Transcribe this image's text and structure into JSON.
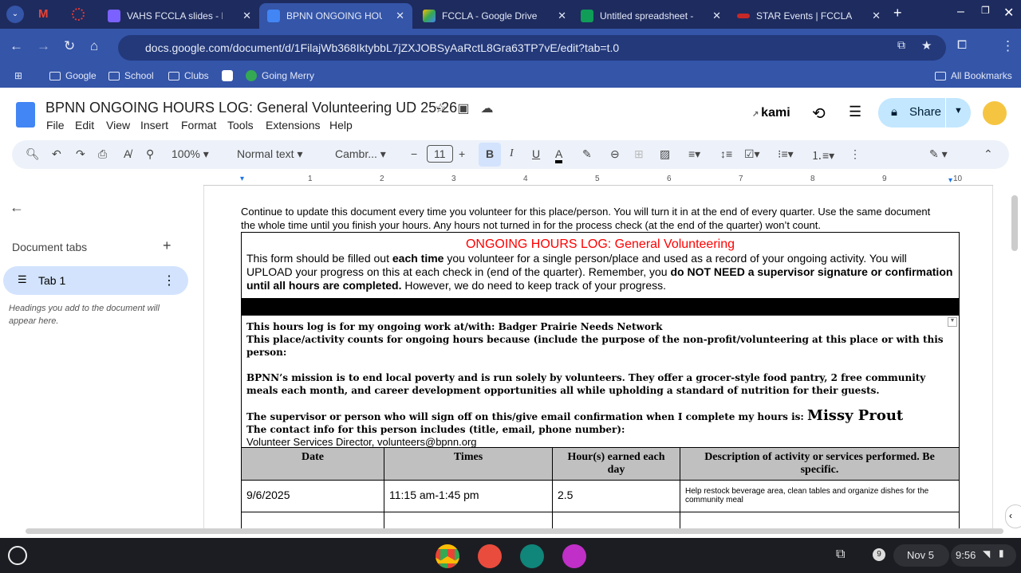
{
  "browser": {
    "tabs": [
      {
        "label": "VAHS FCCLA slides - Pres"
      },
      {
        "label": "BPNN ONGOING HOURS L"
      },
      {
        "label": "FCCLA - Google Drive"
      },
      {
        "label": "Untitled spreadsheet - Goo"
      },
      {
        "label": "STAR Events | FCCLA"
      }
    ],
    "url": "docs.google.com/document/d/1FilajWb368IktybbL7jZXJOBSyAaRctL8Gra63TP7vE/edit?tab=t.0",
    "bookmarks": [
      "Google",
      "School",
      "Clubs",
      "Going Merry"
    ],
    "all_bookmarks": "All Bookmarks"
  },
  "docs": {
    "title": "BPNN ONGOING HOURS LOG: General Volunteering UD 25-26",
    "menu": [
      "File",
      "Edit",
      "View",
      "Insert",
      "Format",
      "Tools",
      "Extensions",
      "Help"
    ],
    "kami": "kami",
    "share": "Share",
    "toolbar": {
      "zoom": "100%",
      "style": "Normal text",
      "font": "Cambr...",
      "size": "11"
    },
    "ruler": [
      "1",
      "2",
      "3",
      "4",
      "5",
      "6",
      "7",
      "8",
      "9",
      "10"
    ]
  },
  "sidebar": {
    "header": "Document tabs",
    "tab": "Tab 1",
    "hint": "Headings you add to the document will appear here."
  },
  "document": {
    "intro": "Continue to update this document every time you volunteer for this place/person. You will turn it in at the end of every quarter. Use the same document the whole time until you finish your hours. Any hours not turned in for the process check (at the end of the quarter) won’t count.",
    "heading": "ONGOING HOURS LOG: General Volunteering",
    "p1a": "This form should be filled out ",
    "p1b": "each time",
    "p1c": " you volunteer for a single person/place and used as a record of your ongoing activity. You will UPLOAD your progress on this at each check in (end of the quarter). Remember, you ",
    "p1d": "do NOT NEED a supervisor signature or confirmation until all hours are completed.",
    "p1e": " However, we do need to keep track of your progress.",
    "work_at": "This hours log is for my ongoing work at/with: Badger Prairie Needs Network",
    "counts": "This place/activity counts for ongoing hours because (include the purpose of the non-profit/volunteering at this place or with this person:",
    "mission": "BPNN’s mission is to end local poverty and is run solely by volunteers. They offer a grocer-style food pantry, 2 free community meals each month, and career development opportunities all while upholding a standard of nutrition for their guests.",
    "supervisor_label": "The supervisor or person who will sign off on this/give email confirmation when I complete my hours is: ",
    "supervisor": "Missy Prout",
    "contact_label": "The contact info for this person includes (title, email, phone number):",
    "contact": "Volunteer Services Director, volunteers@bpnn.org",
    "table": {
      "headers": [
        "Date",
        "Times",
        "Hour(s) earned each day",
        "Description of activity or services performed. Be specific."
      ],
      "rows": [
        [
          "9/6/2025",
          "11:15 am-1:45 pm",
          "2.5",
          "Help restock beverage area, clean tables and organize dishes for the community meal"
        ]
      ]
    }
  },
  "shelf": {
    "notifications": "9",
    "date": "Nov 5",
    "time": "9:56"
  }
}
